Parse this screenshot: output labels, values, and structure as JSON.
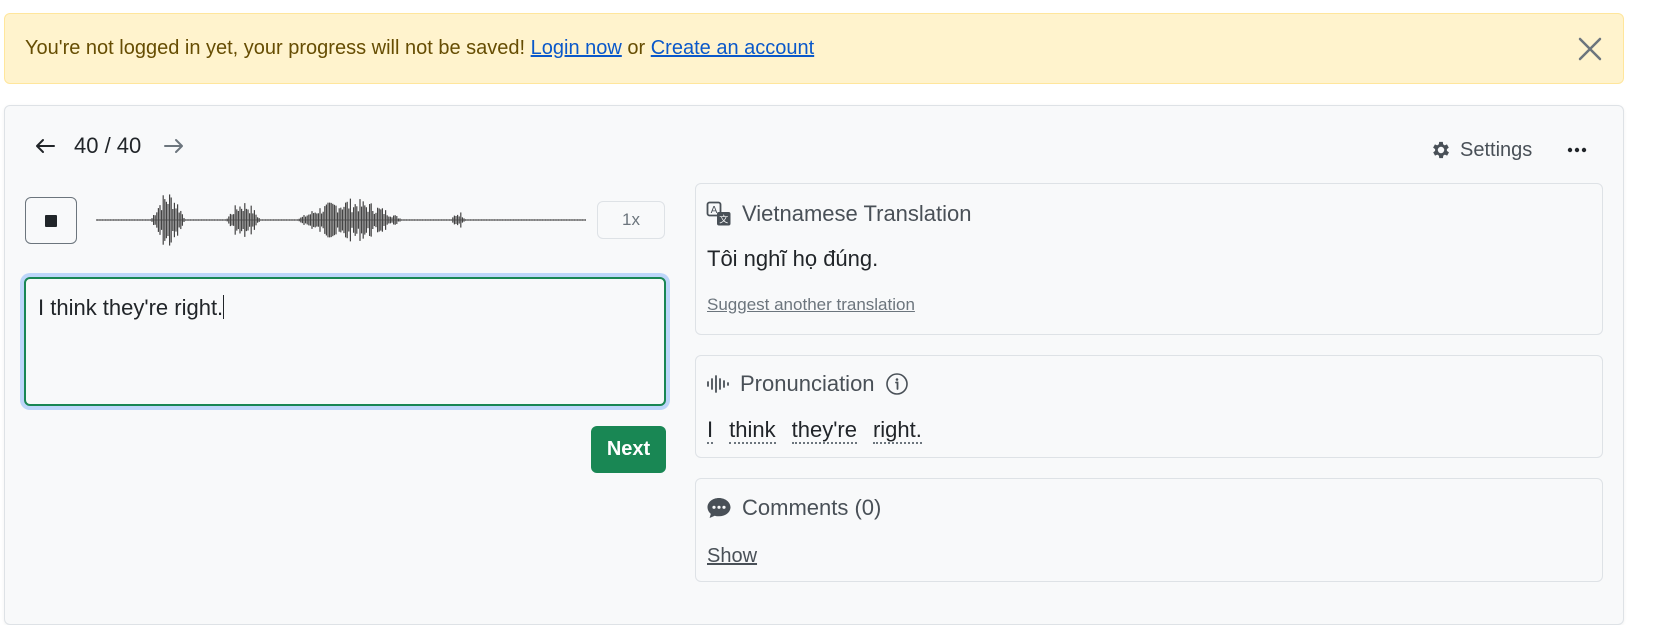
{
  "alert": {
    "message": "You're not logged in yet, your progress will not be saved!",
    "login_link": "Login now",
    "or_text": "or",
    "signup_link": "Create an account",
    "bg_color": "#fff3cd"
  },
  "nav": {
    "counter": "40 / 40",
    "prev_icon": "arrow-left-icon",
    "next_icon": "arrow-right-icon",
    "settings_label": "Settings",
    "more_icon": "ellipsis-icon"
  },
  "player": {
    "stop_icon": "stop-icon",
    "speed": "1x"
  },
  "answer": {
    "value": "I think they're right."
  },
  "next_button": "Next",
  "translation": {
    "title": "Vietnamese Translation",
    "text": "Tôi nghĩ họ đúng.",
    "suggest_link": "Suggest another translation"
  },
  "pronunciation": {
    "title": "Pronunciation",
    "words": [
      "I",
      "think",
      "they're",
      "right."
    ]
  },
  "comments": {
    "title": "Comments (0)",
    "show_link": "Show"
  },
  "colors": {
    "accent": "#198754",
    "link": "#0a58ca",
    "focus": "#0d6efd"
  }
}
